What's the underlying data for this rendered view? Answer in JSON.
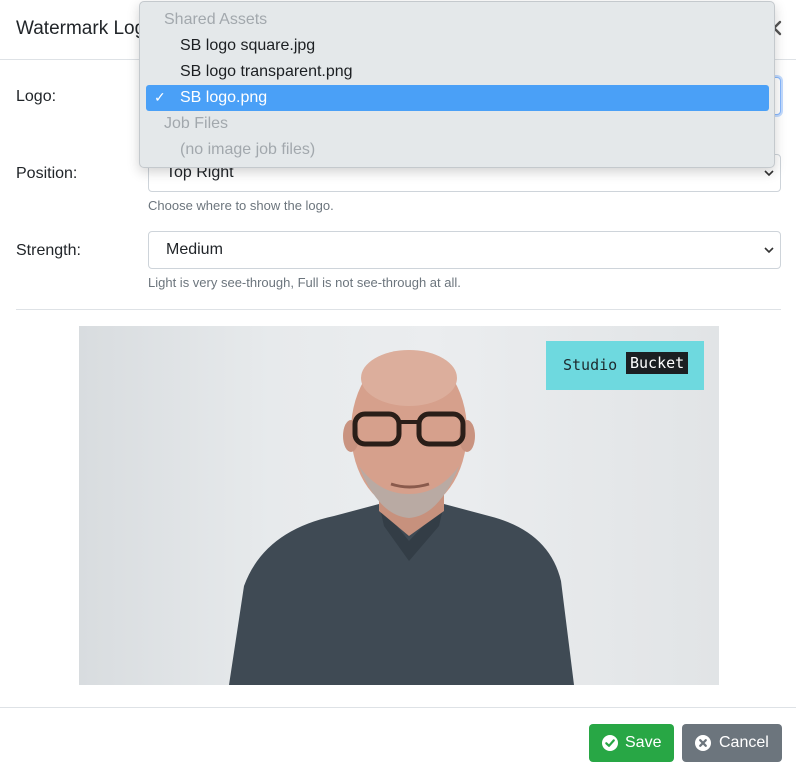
{
  "modal": {
    "title": "Watermark Logo"
  },
  "form": {
    "logo": {
      "label": "Logo:"
    },
    "position": {
      "label": "Position:",
      "value": "Top Right",
      "help": "Choose where to show the logo."
    },
    "strength": {
      "label": "Strength:",
      "value": "Medium",
      "help": "Light is very see-through, Full is not see-through at all."
    }
  },
  "dropdown": {
    "groups": [
      {
        "label": "Shared Assets",
        "options": [
          "SB logo square.jpg",
          "SB logo transparent.png",
          "SB logo.png"
        ]
      },
      {
        "label": "Job Files",
        "options": [
          "(no image job files)"
        ]
      }
    ],
    "selected": "SB logo.png",
    "check_glyph": "✓"
  },
  "preview": {
    "watermark": {
      "studio": "Studio",
      "bucket": "Bucket",
      "color": "#6ed9df"
    }
  },
  "footer": {
    "save_label": "Save",
    "cancel_label": "Cancel"
  },
  "colors": {
    "save": "#28a745",
    "cancel": "#6c757d",
    "selected_option": "#4aa0f7"
  }
}
